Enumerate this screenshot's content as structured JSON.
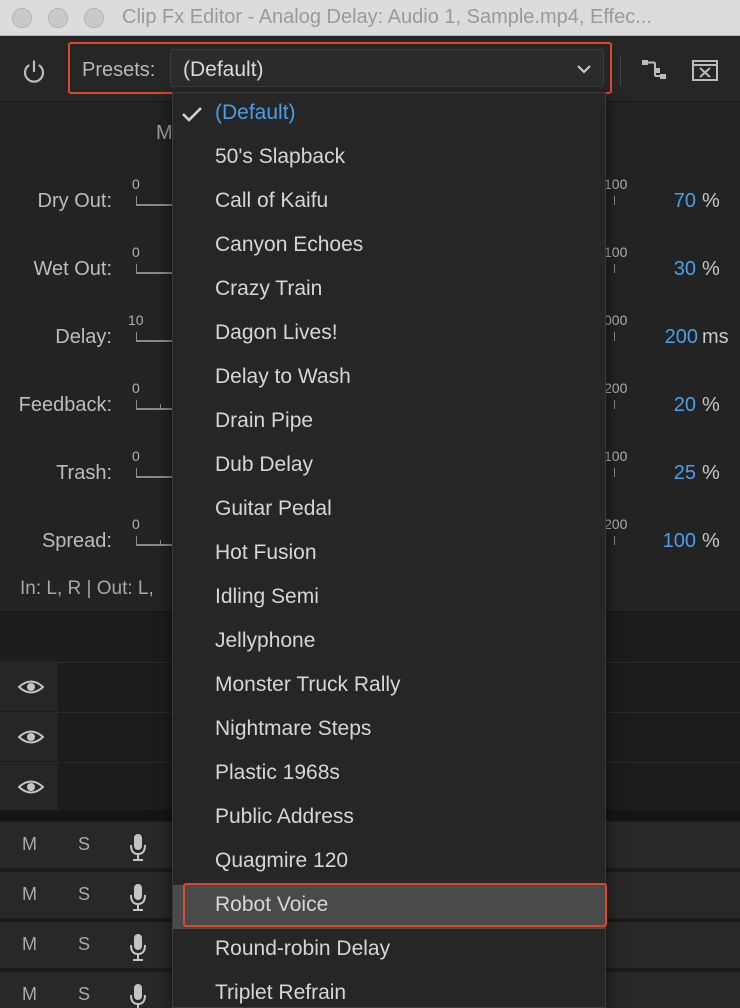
{
  "window": {
    "title": "Clip Fx Editor - Analog Delay: Audio 1, Sample.mp4, Effec..."
  },
  "toolbar": {
    "presets_label": "Presets:",
    "presets_value": "(Default)",
    "power_icon": "power-icon",
    "route_icon": "routing-icon",
    "close_icon": "close-panel-icon"
  },
  "effect": {
    "mode_letter": "M",
    "params": [
      {
        "label": "Dry Out:",
        "min": "0",
        "max": "100",
        "value": "70",
        "unit": "%"
      },
      {
        "label": "Wet Out:",
        "min": "0",
        "max": "100",
        "value": "30",
        "unit": "%"
      },
      {
        "label": "Delay:",
        "min": "10",
        "max": "000",
        "value": "200",
        "unit": "ms"
      },
      {
        "label": "Feedback:",
        "min": "0",
        "max": "200",
        "value": "20",
        "unit": "%"
      },
      {
        "label": "Trash:",
        "min": "0",
        "max": "100",
        "value": "25",
        "unit": "%"
      },
      {
        "label": "Spread:",
        "min": "0",
        "max": "200",
        "value": "100",
        "unit": "%"
      }
    ],
    "io_text": "In: L, R | Out: L,"
  },
  "tracks": {
    "mute_label": "M",
    "solo_label": "S"
  },
  "dropdown": {
    "items": [
      "(Default)",
      "50's Slapback",
      "Call of Kaifu",
      "Canyon Echoes",
      "Crazy Train",
      "Dagon Lives!",
      "Delay to Wash",
      "Drain Pipe",
      "Dub Delay",
      "Guitar Pedal",
      "Hot Fusion",
      "Idling Semi",
      "Jellyphone",
      "Monster Truck Rally",
      "Nightmare Steps",
      "Plastic 1968s",
      "Public Address",
      "Quagmire 120",
      "Robot Voice",
      "Round-robin Delay",
      "Triplet Refrain"
    ],
    "selected": "(Default)",
    "hovered": "Robot Voice"
  },
  "colors": {
    "accent_blue": "#4a9ee8",
    "highlight_red": "#e0452b"
  }
}
